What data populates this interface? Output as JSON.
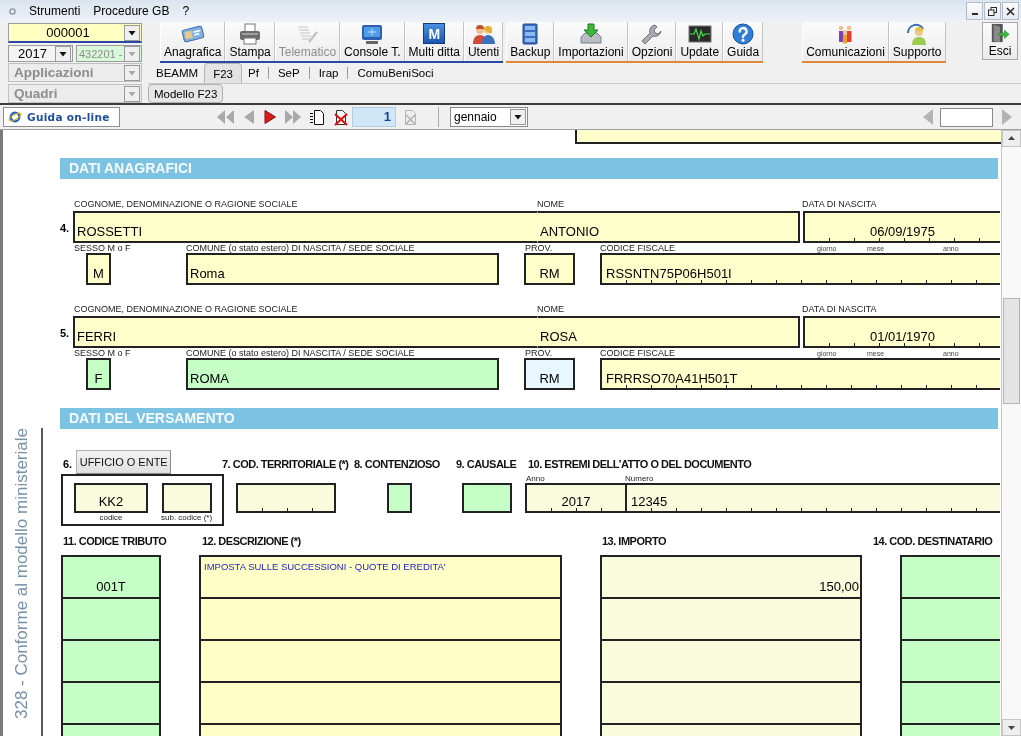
{
  "menu": {
    "items": [
      "Strumenti",
      "Procedure GB",
      "?"
    ]
  },
  "selectors": [
    {
      "kind": "company",
      "value": "000001",
      "disabled": false
    },
    {
      "kind": "year",
      "value": "2017",
      "disabled": false
    },
    {
      "kind": "activity",
      "value": "432201 -",
      "disabled": true
    },
    {
      "kind": "group",
      "value": "Applicazioni",
      "disabled": true
    },
    {
      "kind": "group",
      "value": "Quadri",
      "disabled": true
    }
  ],
  "toolbar": [
    {
      "color": "#2a48a8",
      "buttons": [
        {
          "label": "Anagrafica",
          "disabled": false
        },
        {
          "label": "Stampa",
          "disabled": false
        },
        {
          "label": "Telematico",
          "disabled": true
        },
        {
          "label": "Console T.",
          "disabled": false
        },
        {
          "label": "Multi ditta",
          "icon_text": "M",
          "disabled": false
        },
        {
          "label": "Utenti",
          "disabled": false
        }
      ]
    },
    {
      "color": "#e0883a",
      "buttons": [
        {
          "label": "Backup",
          "disabled": false
        },
        {
          "label": "Importazioni",
          "disabled": false
        },
        {
          "label": "Opzioni",
          "disabled": false
        },
        {
          "label": "Update",
          "disabled": false
        },
        {
          "label": "Guida",
          "disabled": false
        }
      ]
    },
    {
      "color": "#e0883a",
      "buttons": [
        {
          "label": "Comunicazioni",
          "disabled": false
        },
        {
          "label": "Supporto",
          "disabled": false
        }
      ]
    }
  ],
  "exit_button": {
    "label": "Esci"
  },
  "tabs": [
    {
      "label": "BEAMM",
      "selected": false
    },
    {
      "label": "F23",
      "selected": true
    },
    {
      "label": "Pf",
      "selected": false
    },
    {
      "label": "SeP",
      "selected": false
    },
    {
      "label": "Irap",
      "selected": false
    },
    {
      "label": "ComuBeniSoci",
      "selected": false
    }
  ],
  "subtabs": [
    {
      "label": "Modello F23",
      "selected": true
    }
  ],
  "navigator": {
    "help_button": "Guida on-line",
    "page": "1",
    "month": "gennaio"
  },
  "form": {
    "personal": {
      "title": "DATI ANAGRAFICI",
      "people": [
        {
          "number": "4.",
          "surname": {
            "label": "COGNOME, DENOMINAZIONE O RAGIONE SOCIALE",
            "value": "ROSSETTI",
            "color": "#ffffcc"
          },
          "first_name": {
            "label": "NOME",
            "value": "ANTONIO",
            "color": "#ffffcc"
          },
          "birth_date": {
            "label": "DATA DI NASCITA",
            "value": "06/09/1975",
            "parts": [
              "giorno",
              "mese",
              "anno"
            ],
            "color": "#ffffcc"
          },
          "sex": {
            "label": "SESSO M o F",
            "value": "M",
            "color": "#ffffcc"
          },
          "birthplace": {
            "label": "COMUNE (o stato estero) DI NASCITA / SEDE SOCIALE",
            "value": "Roma",
            "color": "#ffffcc"
          },
          "province": {
            "label": "PROV.",
            "value": "RM",
            "color": "#ffffcc"
          },
          "tax_code": {
            "label": "CODICE FISCALE",
            "value": "RSSNTN75P06H501I",
            "color": "#ffffcc"
          }
        },
        {
          "number": "5.",
          "surname": {
            "label": "COGNOME, DENOMINAZIONE O RAGIONE SOCIALE",
            "value": "FERRI",
            "color": "#ffffcc"
          },
          "first_name": {
            "label": "NOME",
            "value": "ROSA",
            "color": "#ffffcc"
          },
          "birth_date": {
            "label": "DATA DI NASCITA",
            "value": "01/01/1970",
            "parts": [
              "giorno",
              "mese",
              "anno"
            ],
            "color": "#ffffcc"
          },
          "sex": {
            "label": "SESSO M o F",
            "value": "F",
            "color": "#c6ffc6"
          },
          "birthplace": {
            "label": "COMUNE (o stato estero) DI NASCITA / SEDE SOCIALE",
            "value": "ROMA",
            "color": "#c6ffc6"
          },
          "province": {
            "label": "PROV.",
            "value": "RM",
            "color": "#e8f7fd"
          },
          "tax_code": {
            "label": "CODICE FISCALE",
            "value": "FRRRSO70A41H501T",
            "color": "#ffffcc"
          }
        }
      ]
    },
    "payment": {
      "title": "DATI DEL VERSAMENTO",
      "side_note": "328 - Conforme al modello ministeriale",
      "office": {
        "number": "6.",
        "button": "UFFICIO O ENTE",
        "code": {
          "value": "KK2",
          "caption": "codice",
          "color": "#fafadc"
        },
        "subcode": {
          "caption": "sub. codice (*)",
          "color": "#fafadc"
        }
      },
      "territorial_code": {
        "label": "7. COD. TERRITORIALE (*)",
        "color": "#fafadc"
      },
      "dispute": {
        "label": "8. CONTENZIOSO",
        "color": "#c6ffc6"
      },
      "reason": {
        "label": "9. CAUSALE",
        "color": "#c6ffc6"
      },
      "document": {
        "label": "10. ESTREMI DELL’ATTO O DEL DOCUMENTO",
        "year_label": "Anno",
        "year": "2017",
        "number_label": "Numero",
        "number": "12345",
        "color": "#fafadc"
      },
      "columns": [
        {
          "label": "11. CODICE TRIBUTO",
          "color": "#c6ffc6"
        },
        {
          "label": "12. DESCRIZIONE (*)",
          "color": "#ffffc8"
        },
        {
          "label": "13. IMPORTO",
          "color": "#fafadc"
        },
        {
          "label": "14. COD. DESTINATARIO",
          "color": "#c6ffc6"
        }
      ],
      "rows": [
        {
          "code": "001T",
          "description": "IMPOSTA SULLE SUCCESSIONI - QUOTE DI EREDITA'",
          "amount": "150,00"
        },
        {},
        {},
        {},
        {}
      ]
    }
  }
}
